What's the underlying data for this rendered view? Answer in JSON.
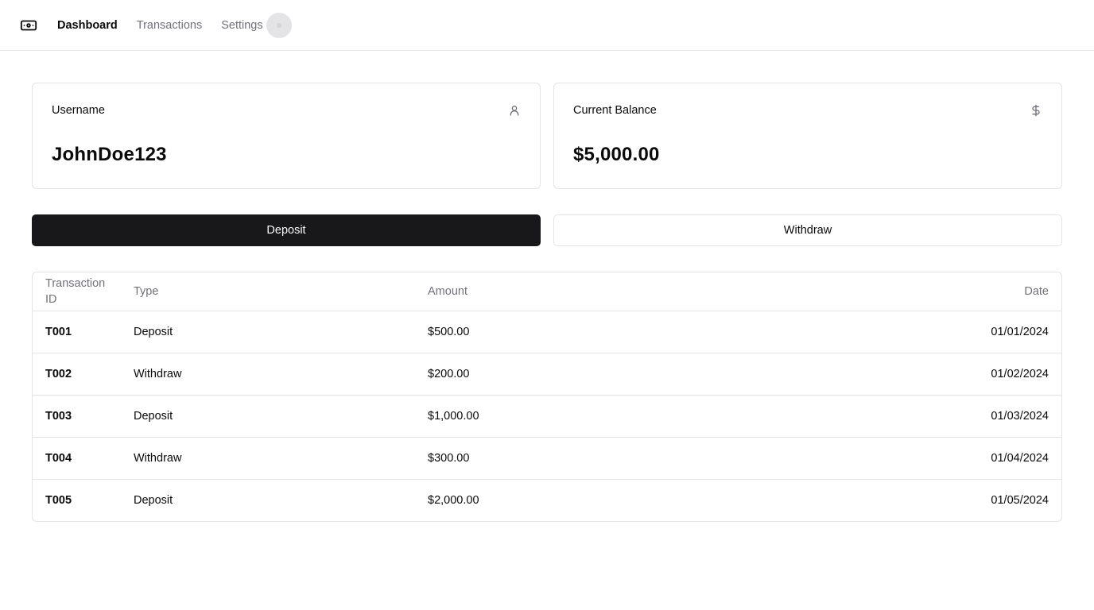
{
  "nav": {
    "logo_icon": "banknote-icon",
    "links": [
      {
        "label": "Dashboard",
        "active": true
      },
      {
        "label": "Transactions",
        "active": false
      },
      {
        "label": "Settings",
        "active": false
      }
    ]
  },
  "cards": {
    "username": {
      "label": "Username",
      "value": "JohnDoe123",
      "icon": "user-icon"
    },
    "balance": {
      "label": "Current Balance",
      "value": "$5,000.00",
      "icon": "dollar-icon"
    }
  },
  "actions": {
    "deposit_label": "Deposit",
    "withdraw_label": "Withdraw"
  },
  "table": {
    "headers": {
      "id": "Transaction ID",
      "type": "Type",
      "amount": "Amount",
      "date": "Date"
    },
    "rows": [
      {
        "id": "T001",
        "type": "Deposit",
        "amount": "$500.00",
        "date": "01/01/2024"
      },
      {
        "id": "T002",
        "type": "Withdraw",
        "amount": "$200.00",
        "date": "01/02/2024"
      },
      {
        "id": "T003",
        "type": "Deposit",
        "amount": "$1,000.00",
        "date": "01/03/2024"
      },
      {
        "id": "T004",
        "type": "Withdraw",
        "amount": "$300.00",
        "date": "01/04/2024"
      },
      {
        "id": "T005",
        "type": "Deposit",
        "amount": "$2,000.00",
        "date": "01/05/2024"
      }
    ]
  },
  "colors": {
    "primary": "#18181b",
    "muted": "#71717a",
    "border": "#e4e4e7"
  }
}
